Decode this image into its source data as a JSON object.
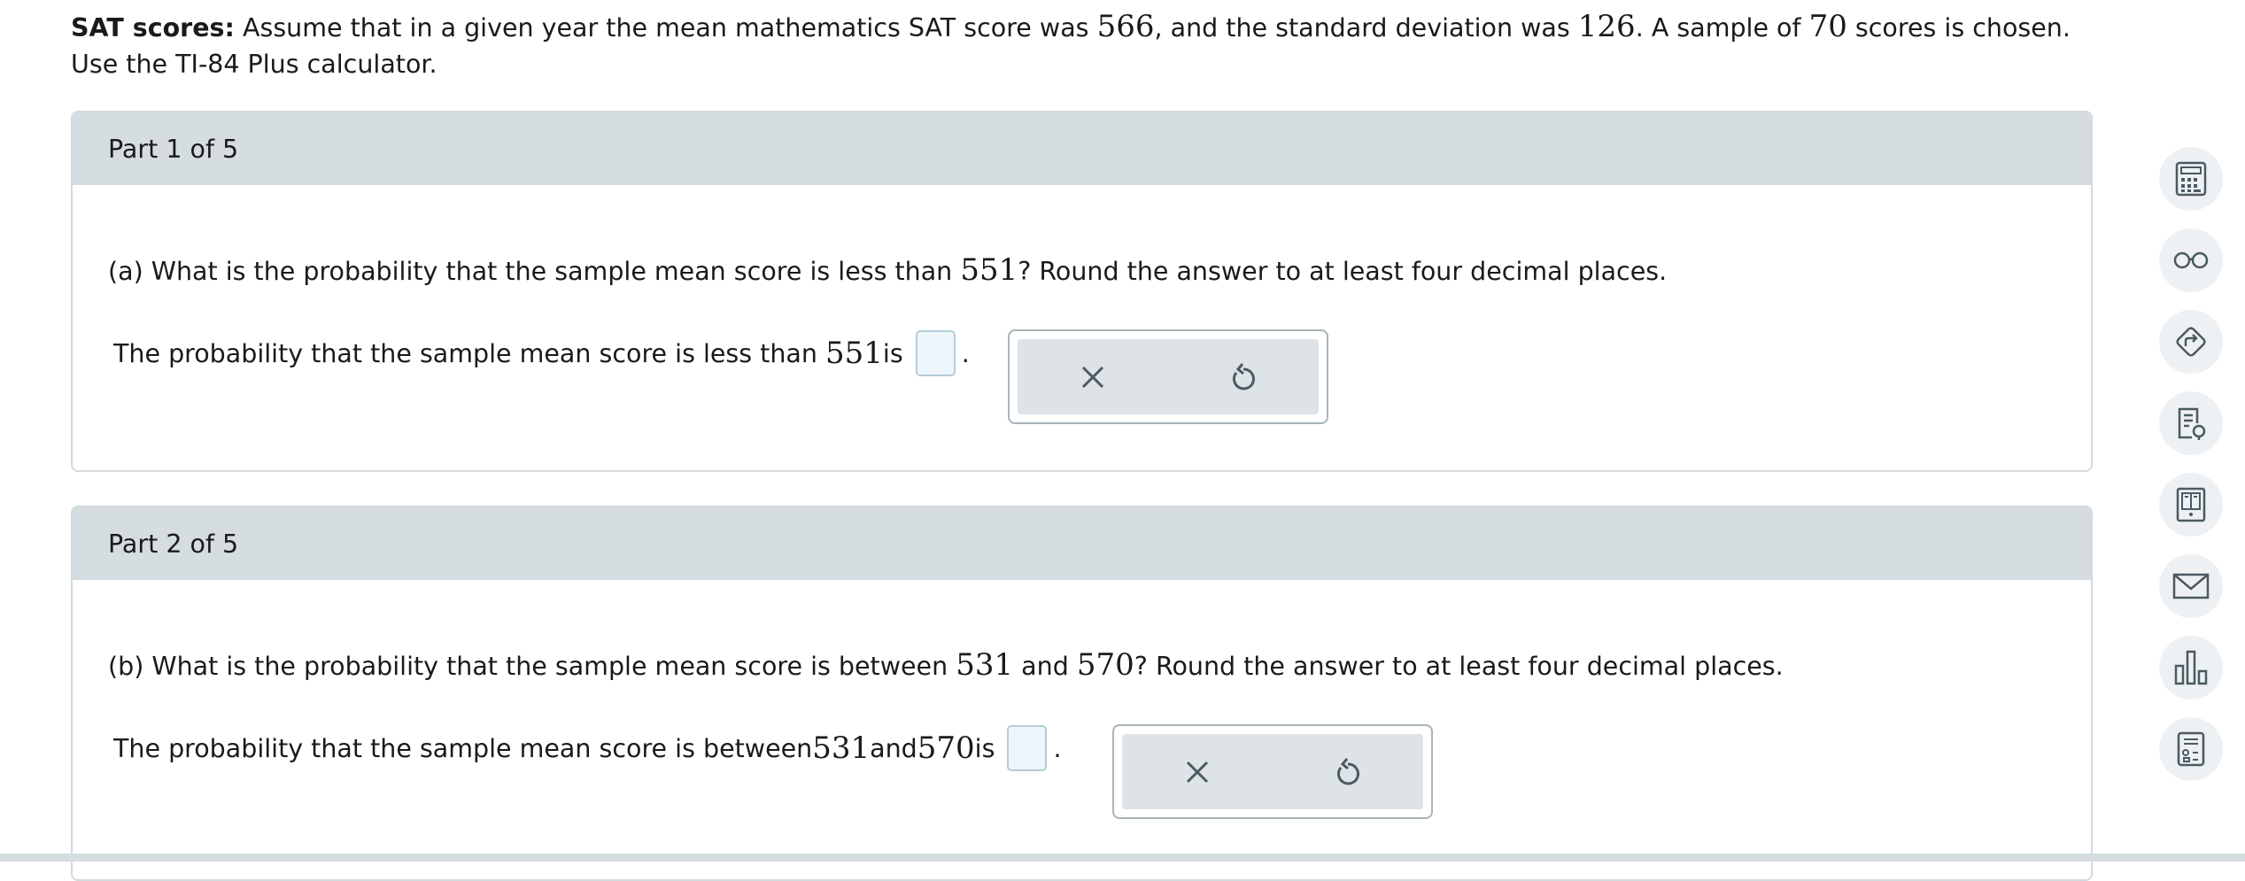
{
  "intro": {
    "label": "SAT scores:",
    "t1": " Assume that in a given year the mean mathematics SAT score was ",
    "mean": "566",
    "t2": ", and the standard deviation was ",
    "sd": "126",
    "t3": ". A sample of ",
    "n": "70",
    "t4": " scores is chosen. Use the TI-84 Plus calculator."
  },
  "parts": [
    {
      "header": "Part 1 of 5",
      "question": {
        "t1": "(a) What is the probability that the sample mean score is less than ",
        "v1": "551",
        "t2": "? Round the answer to at least four decimal places."
      },
      "answer": {
        "t1": "The probability that the sample mean score is less than ",
        "v1": "551",
        "t2": " is",
        "period": ".",
        "value": ""
      }
    },
    {
      "header": "Part 2 of 5",
      "question": {
        "t1": "(b) What is the probability that the sample mean score is between ",
        "v1": "531",
        "t2": " and ",
        "v2": "570",
        "t3": "? Round the answer to at least four decimal places."
      },
      "answer": {
        "t1": "The probability that the sample mean score is between ",
        "v1": "531",
        "t2": " and ",
        "v2": "570",
        "t3": " is",
        "period": ".",
        "value": ""
      }
    }
  ],
  "sidebar": {
    "icons": [
      "calculator-icon",
      "glasses-icon",
      "direction-icon",
      "checklist-icon",
      "ebook-icon",
      "mail-icon",
      "bar-chart-icon",
      "data-calculator-icon"
    ]
  },
  "colors": {
    "header_bg": "#d5dde1",
    "input_bg": "#eef6fb",
    "icon": "#4a5a63"
  }
}
